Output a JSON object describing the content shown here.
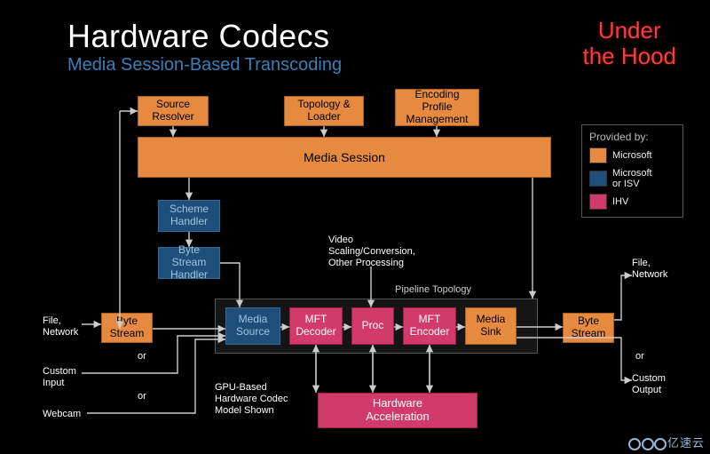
{
  "title": "Hardware Codecs",
  "subtitle": "Media Session-Based Transcoding",
  "corner_line1": "Under",
  "corner_line2": "the Hood",
  "boxes": {
    "source_resolver": "Source\nResolver",
    "topology_loader": "Topology &\nLoader",
    "encoding_profile": "Encoding\nProfile\nManagement",
    "media_session": "Media Session",
    "scheme_handler": "Scheme\nHandler",
    "byte_stream_handler": "Byte\nStream\nHandler",
    "byte_stream_in": "Byte\nStream",
    "media_source": "Media\nSource",
    "mft_decoder": "MFT\nDecoder",
    "proc": "Proc",
    "mft_encoder": "MFT\nEncoder",
    "media_sink": "Media\nSink",
    "byte_stream_out": "Byte\nStream",
    "hw_accel": "Hardware\nAcceleration"
  },
  "labels": {
    "file_network_in": "File,\nNetwork",
    "custom_input": "Custom\nInput",
    "webcam": "Webcam",
    "or1": "or",
    "or2": "or",
    "or3": "or",
    "video_proc": "Video\nScaling/Conversion,\nOther Processing",
    "pipeline_topology": "Pipeline Topology",
    "gpu_note": "GPU-Based\nHardware Codec\nModel Shown",
    "file_network_out": "File,\nNetwork",
    "custom_output": "Custom\nOutput"
  },
  "legend": {
    "title": "Provided by:",
    "microsoft": "Microsoft",
    "microsoft_isv": "Microsoft\nor ISV",
    "ihv": "IHV"
  },
  "watermark": "亿速云"
}
